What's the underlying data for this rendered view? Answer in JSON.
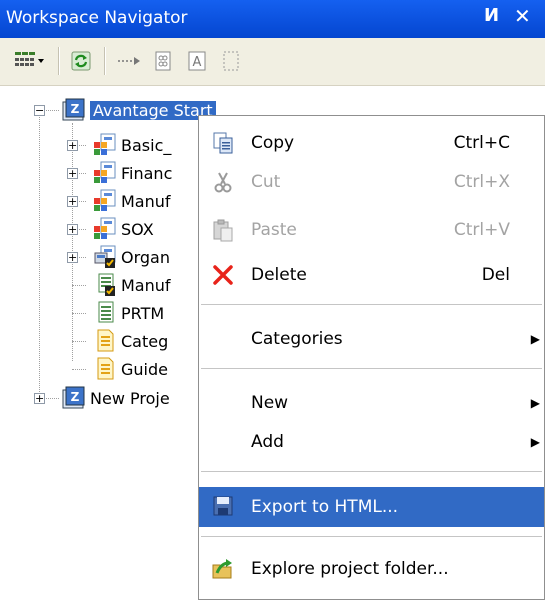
{
  "window": {
    "title": "Workspace Navigator",
    "pin_glyph": "И",
    "close_glyph": "✕"
  },
  "toolbar": {
    "buttons": [
      "view-options-icon",
      "refresh-icon",
      "link-icon",
      "object-icon",
      "text-icon",
      "select-icon"
    ]
  },
  "tree": {
    "items": [
      {
        "label": "Avantage Start",
        "icon": "project-icon",
        "selected": true
      },
      {
        "label": "Basic_",
        "icon": "model-icon"
      },
      {
        "label": "Financ",
        "icon": "model-icon"
      },
      {
        "label": "Manuf",
        "icon": "model-icon"
      },
      {
        "label": "SOX",
        "icon": "model-icon"
      },
      {
        "label": "Organ",
        "icon": "org-model-icon"
      },
      {
        "label": "Manuf",
        "icon": "org-model-icon"
      },
      {
        "label": "PRTM",
        "icon": "diagram-icon"
      },
      {
        "label": "Categ",
        "icon": "document-icon"
      },
      {
        "label": "Guide",
        "icon": "document-icon"
      },
      {
        "label": "New Proje",
        "icon": "project-icon"
      }
    ]
  },
  "menu": {
    "copy": {
      "label": "Copy",
      "shortcut": "Ctrl+C"
    },
    "cut": {
      "label": "Cut",
      "shortcut": "Ctrl+X"
    },
    "paste": {
      "label": "Paste",
      "shortcut": "Ctrl+V"
    },
    "delete": {
      "label": "Delete",
      "shortcut": "Del"
    },
    "categories": {
      "label": "Categories"
    },
    "new": {
      "label": "New"
    },
    "add": {
      "label": "Add"
    },
    "export": {
      "label": "Export to HTML..."
    },
    "explore": {
      "label": "Explore project folder..."
    }
  },
  "colors": {
    "titlebar": "#0a50e0",
    "selection": "#316ac5",
    "disabled_text": "#a3a3a3",
    "delete_x": "#e8231a"
  }
}
